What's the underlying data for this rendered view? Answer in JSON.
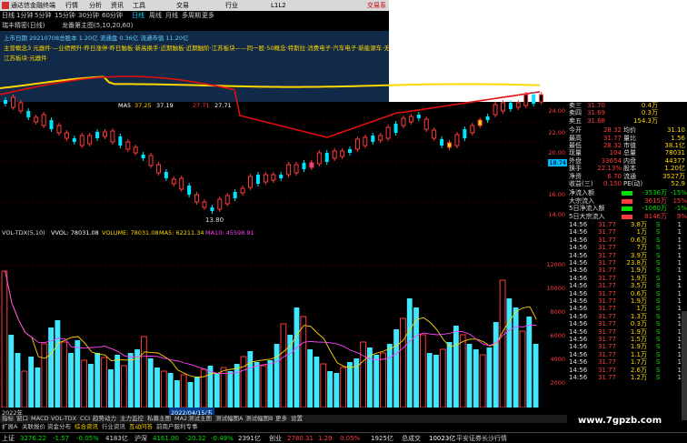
{
  "titlebar": {
    "app_title": "通达信金融终端",
    "menus": [
      "行情",
      "分析",
      "资讯",
      "工具",
      "交易",
      "行业",
      "L1L2"
    ],
    "trade_label": "交易系"
  },
  "toolbar": {
    "items": [
      "日线",
      "1分钟",
      "5分钟",
      "15分钟",
      "30分钟",
      "60分钟",
      "日线",
      "周线",
      "月线",
      "多周期",
      "更多"
    ]
  },
  "stock": {
    "name_line": "瑞丰精密(日线)",
    "overlay": "龙番第主图(5,10,20,60)"
  },
  "banner": {
    "line1": "上市日期 20210708总股本 1.20亿  流通盘 0.36亿  流通市值 11.20亿",
    "line2": "主营概念3 元器件·—业绩预升·昨日涨停·昨日触板·新高换手·近期触板·近期触阶·江苏板块——同一股·50概念·特斯拉·消费电子·汽车电子·新能源车·无人",
    "line3": "江苏板块·元器件"
  },
  "kline_head": {
    "ma5": "37.25",
    "ma10": "37.19",
    "ma20": "27.71",
    "ma60": "27.71"
  },
  "price_axis": [
    "24.00",
    "22.00",
    "20.00",
    "18.74",
    "16.00",
    "14.00"
  ],
  "low_label": "13.80",
  "quote": {
    "sells": [
      {
        "label": "卖三",
        "price": "31.70",
        "vol": "0.4万"
      },
      {
        "label": "卖四",
        "price": "31.69",
        "vol": "0.3万"
      },
      {
        "label": "卖五",
        "price": "31.68",
        "vol": "154.3万"
      }
    ],
    "stats": [
      {
        "l1": "今开",
        "v1": "28.32",
        "l2": "均价",
        "v2": "31.10"
      },
      {
        "l1": "最高",
        "v1": "31.77",
        "l2": "量比",
        "v2": "1.56"
      },
      {
        "l1": "最低",
        "v1": "28.32",
        "l2": "市值",
        "v2": "38.1亿"
      },
      {
        "l1": "现量",
        "v1": "104",
        "l2": "总量",
        "v2": "78031"
      },
      {
        "l1": "外盘",
        "v1": "33654",
        "l2": "内盘",
        "v2": "44377"
      },
      {
        "l1": "换手",
        "v1": "22.13%",
        "l2": "股本",
        "v2": "1.20亿"
      },
      {
        "l1": "净资",
        "v1": "6.70",
        "l2": "流通",
        "v2": "3527万"
      },
      {
        "l1": "收益(三)",
        "v1": "0.150",
        "l2": "PE(动)",
        "v2": "52.9"
      }
    ],
    "flows": [
      {
        "label": "净流入额",
        "value": "-3536万",
        "pct": "-15%",
        "color": "#00e000"
      },
      {
        "label": "大宗流入",
        "value": "3615万",
        "pct": "15%",
        "color": "#ff3b3b"
      },
      {
        "label": "5日净流入额",
        "value": "-1060万",
        "pct": "-1%",
        "color": "#00e000"
      },
      {
        "label": "5日大宗流入",
        "value": "8146万",
        "pct": "9%",
        "color": "#ff3b3b"
      }
    ],
    "ticks": [
      {
        "t": "14:56",
        "p": "31.77",
        "v": "3.8万",
        "d": "S",
        "n": "1"
      },
      {
        "t": "14:56",
        "p": "31.77",
        "v": "1万",
        "d": "S",
        "n": "1"
      },
      {
        "t": "14:56",
        "p": "31.77",
        "v": "0.6万",
        "d": "S",
        "n": "1"
      },
      {
        "t": "14:56",
        "p": "31.77",
        "v": "7万",
        "d": "S",
        "n": "1"
      },
      {
        "t": "14:56",
        "p": "31.77",
        "v": "3.9万",
        "d": "S",
        "n": "1"
      },
      {
        "t": "14:56",
        "p": "31.77",
        "v": "23.8万",
        "d": "S",
        "n": "1"
      },
      {
        "t": "14:56",
        "p": "31.77",
        "v": "1.9万",
        "d": "S",
        "n": "1"
      },
      {
        "t": "14:56",
        "p": "31.77",
        "v": "1.9万",
        "d": "S",
        "n": "1"
      },
      {
        "t": "14:56",
        "p": "31.77",
        "v": "3.5万",
        "d": "S",
        "n": "1"
      },
      {
        "t": "14:56",
        "p": "31.77",
        "v": "0.6万",
        "d": "S",
        "n": "1"
      },
      {
        "t": "14:56",
        "p": "31.77",
        "v": "1.9万",
        "d": "S",
        "n": "1"
      },
      {
        "t": "14:56",
        "p": "31.77",
        "v": "1万",
        "d": "S",
        "n": "1"
      },
      {
        "t": "14:56",
        "p": "31.77",
        "v": "1.3万",
        "d": "S",
        "n": "1"
      },
      {
        "t": "14:56",
        "p": "31.77",
        "v": "0.3万",
        "d": "S",
        "n": "1"
      },
      {
        "t": "14:56",
        "p": "31.77",
        "v": "1.9万",
        "d": "S",
        "n": "1"
      },
      {
        "t": "14:56",
        "p": "31.77",
        "v": "1.5万",
        "d": "S",
        "n": "1"
      },
      {
        "t": "14:56",
        "p": "31.77",
        "v": "1.9万",
        "d": "S",
        "n": "1"
      },
      {
        "t": "14:56",
        "p": "31.77",
        "v": "1.1万",
        "d": "S",
        "n": "1"
      },
      {
        "t": "14:56",
        "p": "31.77",
        "v": "1.7万",
        "d": "S",
        "n": "1"
      },
      {
        "t": "14:56",
        "p": "31.77",
        "v": "2.6万",
        "d": "S",
        "n": "1"
      },
      {
        "t": "14:56",
        "p": "31.77",
        "v": "1.2万",
        "d": "S",
        "n": "1"
      }
    ]
  },
  "volhead": {
    "indicator": "VOL-TDX(5,10)",
    "vvol": "VVOL: 78031.08",
    "volume": "VOLUME: 78031.08",
    "ma5": "MA5: 62211.34",
    "ma10": "MA10: 45598.91"
  },
  "vol_axis": [
    "12000",
    "10000",
    "8000",
    "6000",
    "4000",
    "2000"
  ],
  "dates": {
    "left": "2022年",
    "mid": "2022/04/15/五"
  },
  "tabs": [
    "指标",
    "窗口",
    "MACD",
    "VOL-TDX",
    "CCI",
    "趋势动力",
    "主力监控",
    "私募主图",
    "MA2",
    "测试主图",
    "测试幅图A",
    "测试幅图B",
    "更多",
    "设置"
  ],
  "tabs2": [
    "扩展A",
    "关联报价",
    "资金分布",
    "综合资讯",
    "行业资讯",
    "互动问答",
    "前南户服利专事"
  ],
  "status": {
    "sh_label": "上证",
    "sh_val": "3276.22",
    "sh_chg": "-1.57",
    "sh_pct": "-0.05%",
    "sh_amt": "4183亿",
    "sz_label": "沪深",
    "sz_val": "4161.00",
    "sz_chg": "-20.32",
    "sz_pct": "-0.49%",
    "sz_amt": "2391亿",
    "cy_label": "创业",
    "cy_val": "2780.31",
    "cy_chg": "1.29",
    "cy_pct": "0.05%",
    "cy_amt": "1925亿",
    "total_label": "总成交",
    "total_val": "10023亿",
    "news": "平安证券长沙行情"
  },
  "watermark": "www.7gpzb.com",
  "colors": {
    "up": "#ff3b3b",
    "down": "#00e5ff",
    "ma_yellow": "#ffd700",
    "ma_red": "#e01010"
  }
}
